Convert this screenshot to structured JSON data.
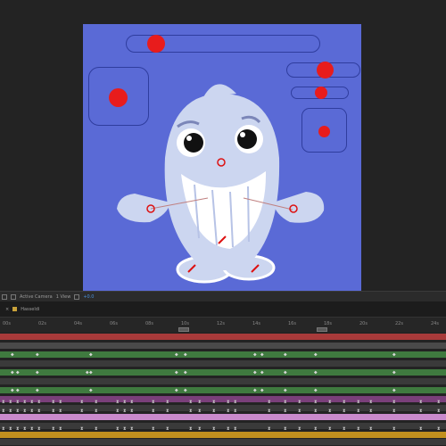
{
  "colors": {
    "comp_bg": "#5a6ad6",
    "track_red": "#a83a3a",
    "track_green": "#3f7a3f",
    "track_purple": "#7a3f7a",
    "track_gold": "#c2901e"
  },
  "viewer_bar": {
    "camera": "Active Camera",
    "view": "1 View",
    "exposure": "+0.0"
  },
  "timeline": {
    "tab_label": "Hasseldi",
    "ruler_labels": [
      "00s",
      "02s",
      "04s",
      "06s",
      "08s",
      "10s",
      "12s",
      "14s",
      "16s",
      "18s",
      "20s",
      "22s",
      "24s"
    ]
  },
  "icons": {
    "close": "close-icon",
    "composition": "composition-icon",
    "camera": "camera-icon",
    "grid": "grid-icon"
  }
}
